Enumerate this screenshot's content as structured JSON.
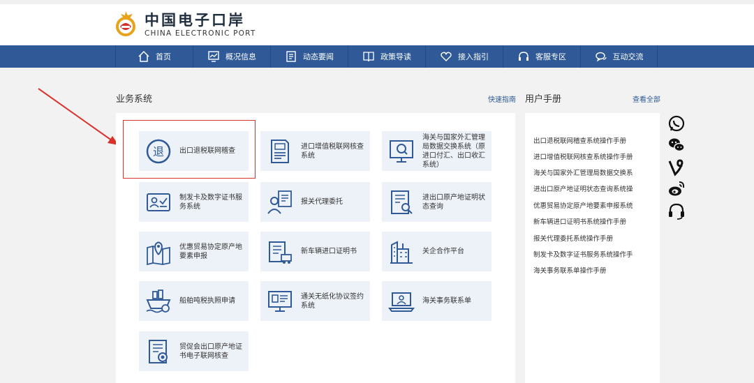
{
  "header": {
    "logo_cn": "中国电子口岸",
    "logo_en": "CHINA ELECTRONIC PORT"
  },
  "nav": [
    {
      "label": "首页",
      "icon": "home-icon"
    },
    {
      "label": "概况信息",
      "icon": "chart-icon"
    },
    {
      "label": "动态要闻",
      "icon": "news-icon"
    },
    {
      "label": "政策导读",
      "icon": "book-icon"
    },
    {
      "label": "接入指引",
      "icon": "heart-icon"
    },
    {
      "label": "客服专区",
      "icon": "headset-icon"
    },
    {
      "label": "互动交流",
      "icon": "chat-icon"
    }
  ],
  "business": {
    "title": "业务系统",
    "link": "快速指南",
    "tiles": [
      {
        "label": "出口退税联网稽查",
        "icon": "tax-refund-icon"
      },
      {
        "label": "进口增值税联网核查系统",
        "icon": "document-icon"
      },
      {
        "label": "海关与国家外汇管理局数据交换系统（原进口付汇、出口收汇系统）",
        "icon": "monitor-search-icon"
      },
      {
        "label": "制发卡及数字证书服务系统",
        "icon": "id-card-icon"
      },
      {
        "label": "报关代理委托",
        "icon": "agent-icon"
      },
      {
        "label": "进出口原产地证明状态查询",
        "icon": "certificate-search-icon"
      },
      {
        "label": "优惠贸易协定原产地要素申报",
        "icon": "map-pin-icon"
      },
      {
        "label": "新车辆进口证明书",
        "icon": "vehicle-doc-icon"
      },
      {
        "label": "关企合作平台",
        "icon": "building-icon"
      },
      {
        "label": "船舶吨税执照申请",
        "icon": "ship-icon"
      },
      {
        "label": "通关无纸化协议签约系统",
        "icon": "screen-sign-icon"
      },
      {
        "label": "海关事务联系单",
        "icon": "laptop-user-icon"
      },
      {
        "label": "贸促会出口原产地证书电子联网核查",
        "icon": "certificate-check-icon"
      }
    ]
  },
  "manual": {
    "title": "用户手册",
    "link": "查看全部",
    "items": [
      "出口退税联网稽查系统操作手册",
      "进口增值税联网核查系统操作手册",
      "海关与国家外汇管理局数据交换系",
      "进出口原产地证明状态查询系统操",
      "优惠贸易协定原产地要素申报系统",
      "新车辆进口证明书系统操作手册",
      "报关代理委托系统操作手册",
      "制发卡及数字证书服务系统操作手",
      "海关事务联系单操作手册"
    ]
  },
  "side_icons": [
    "whatsapp-icon",
    "wechat-icon",
    "vine-icon",
    "weibo-icon",
    "headset-icon"
  ],
  "colors": {
    "nav_bg": "#2f5a97",
    "tile_bg": "#edf2f8",
    "icon_blue": "#2f5a97",
    "highlight_red": "#d9322c"
  }
}
